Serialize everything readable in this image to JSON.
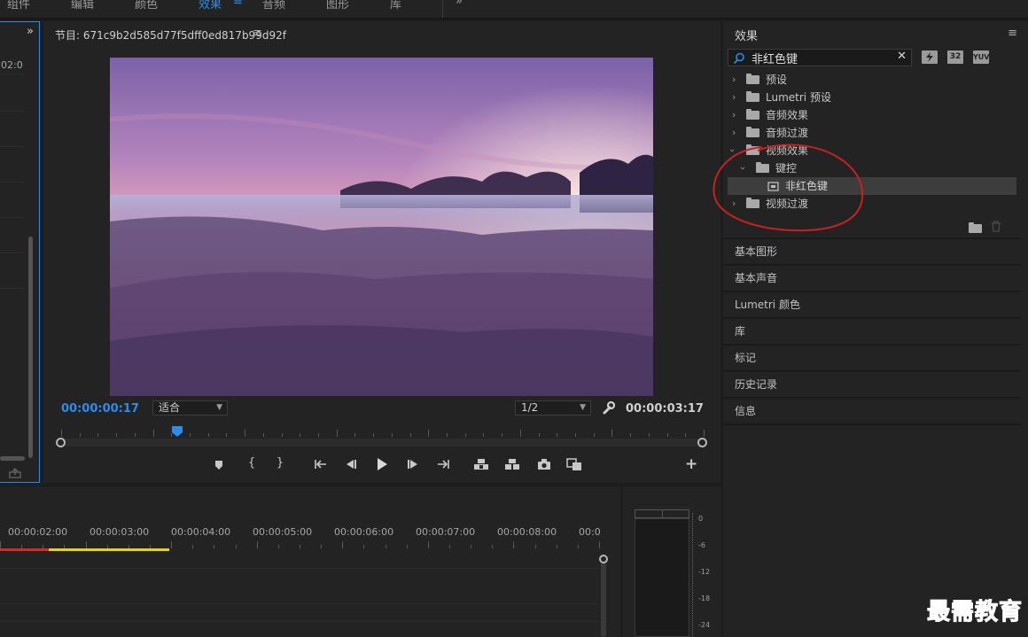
{
  "workspace": {
    "tabs": [
      "组件",
      "编辑",
      "颜色",
      "效果",
      "音频",
      "图形",
      "库"
    ],
    "active_tab": "效果",
    "menu_glyph": "≡",
    "more_glyph": "»"
  },
  "left_panel": {
    "expand_glyph": "»",
    "timecode_fragment": "02:0"
  },
  "program_monitor": {
    "title": "节目: 671c9b2d585d77f5dff0ed817b99d92f",
    "menu_glyph": "≡",
    "current_time": "00:00:00:17",
    "fit_label": "适合",
    "resolution": "1/2",
    "duration": "00:00:03:17",
    "playhead_fraction": 0.18,
    "controls": [
      "add-marker",
      "mark-in",
      "mark-out",
      "go-to-in",
      "step-back",
      "play",
      "step-forward",
      "go-to-out",
      "lift",
      "extract",
      "export-frame",
      "comparison-view"
    ],
    "add_button": "+"
  },
  "effects_panel": {
    "title": "效果",
    "menu_glyph": "≡",
    "search": {
      "value": "非红色键"
    },
    "filter_buttons": [
      "32",
      "YUV"
    ],
    "tree": [
      {
        "label": "预设",
        "level": 0,
        "expanded": false,
        "icon": "preset-folder"
      },
      {
        "label": "Lumetri 预设",
        "level": 0,
        "expanded": false,
        "icon": "preset-folder"
      },
      {
        "label": "音频效果",
        "level": 0,
        "expanded": false,
        "icon": "folder"
      },
      {
        "label": "音频过渡",
        "level": 0,
        "expanded": false,
        "icon": "folder"
      },
      {
        "label": "视频效果",
        "level": 0,
        "expanded": true,
        "icon": "folder"
      },
      {
        "label": "键控",
        "level": 1,
        "expanded": true,
        "icon": "folder"
      },
      {
        "label": "非红色键",
        "level": 2,
        "selected": true,
        "icon": "effect"
      },
      {
        "label": "视频过渡",
        "level": 0,
        "expanded": false,
        "icon": "folder"
      }
    ],
    "sections": [
      "基本图形",
      "基本声音",
      "Lumetri 颜色",
      "库",
      "标记",
      "历史记录",
      "信息"
    ]
  },
  "timeline": {
    "ruler": [
      "00:00:02:00",
      "00:00:03:00",
      "00:00:04:00",
      "00:00:05:00",
      "00:00:06:00",
      "00:00:07:00",
      "00:00:08:00",
      "00:0"
    ]
  },
  "audio_meter": {
    "scale": [
      "0",
      "-6",
      "-12",
      "-18",
      "-24"
    ]
  },
  "watermark": "最需教育",
  "colors": {
    "accent": "#2d8ceb",
    "annotation": "#cc1f1f",
    "render_red": "#d62a2a",
    "render_yellow": "#e3d21c"
  }
}
